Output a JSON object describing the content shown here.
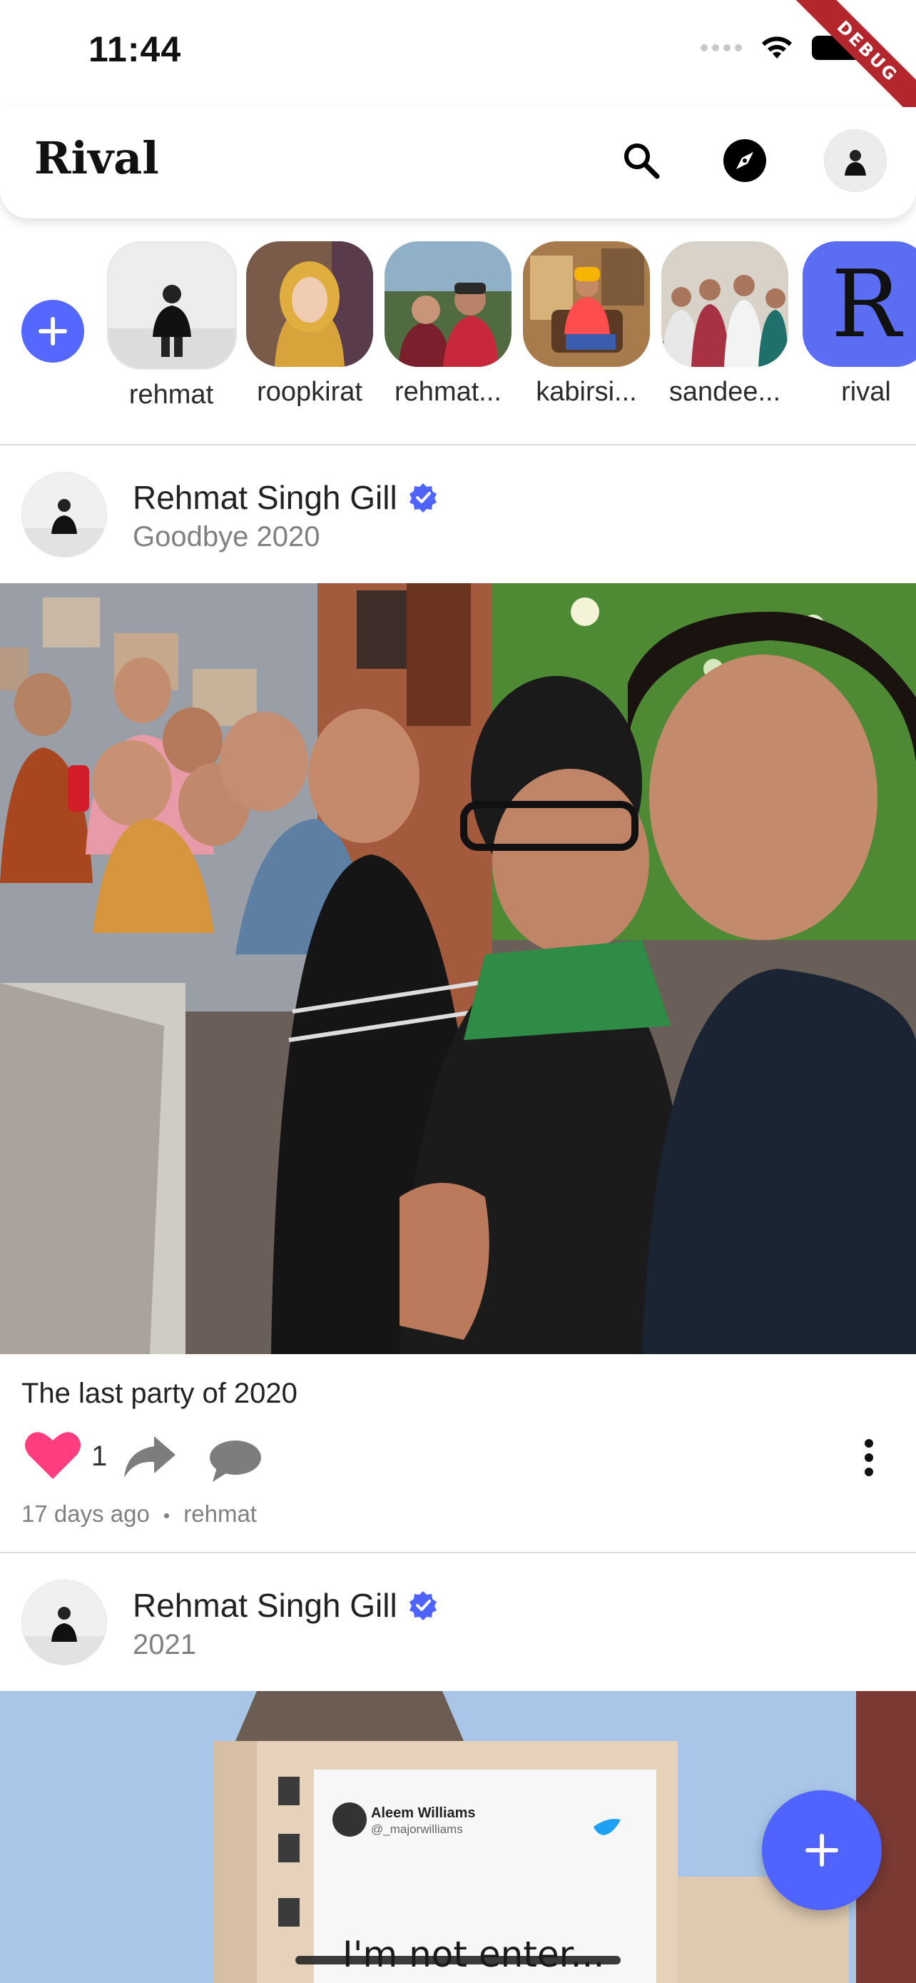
{
  "status_bar": {
    "time": "11:44"
  },
  "debug_banner": "DEBUG",
  "app_bar": {
    "title": "Rival",
    "icons": [
      "search-icon",
      "compass-icon",
      "profile-avatar"
    ]
  },
  "stories": {
    "add_icon": "plus-icon",
    "items": [
      {
        "label": "rehmat"
      },
      {
        "label": "roopkirat"
      },
      {
        "label": "rehmat..."
      },
      {
        "label": "kabirsi..."
      },
      {
        "label": "sandee..."
      },
      {
        "label": "rival",
        "letter": "R"
      }
    ]
  },
  "posts": [
    {
      "author": "Rehmat Singh Gill",
      "verified": true,
      "title": "Goodbye 2020",
      "caption": "The last party of 2020",
      "likes": "1",
      "liked": true,
      "time_ago": "17 days ago",
      "separator": "•",
      "username": "rehmat"
    },
    {
      "author": "Rehmat Singh Gill",
      "verified": true,
      "title": "2021",
      "photo_text": {
        "tweet_name": "Aleem Williams",
        "tweet_handle": "@_majorwilliams",
        "headline": "I'm not enter..."
      }
    }
  ],
  "colors": {
    "accent": "#5468ff",
    "like": "#ff3d7f",
    "verified": "#4f63ff",
    "muted": "#808080"
  },
  "fab": {
    "icon": "plus-icon"
  }
}
